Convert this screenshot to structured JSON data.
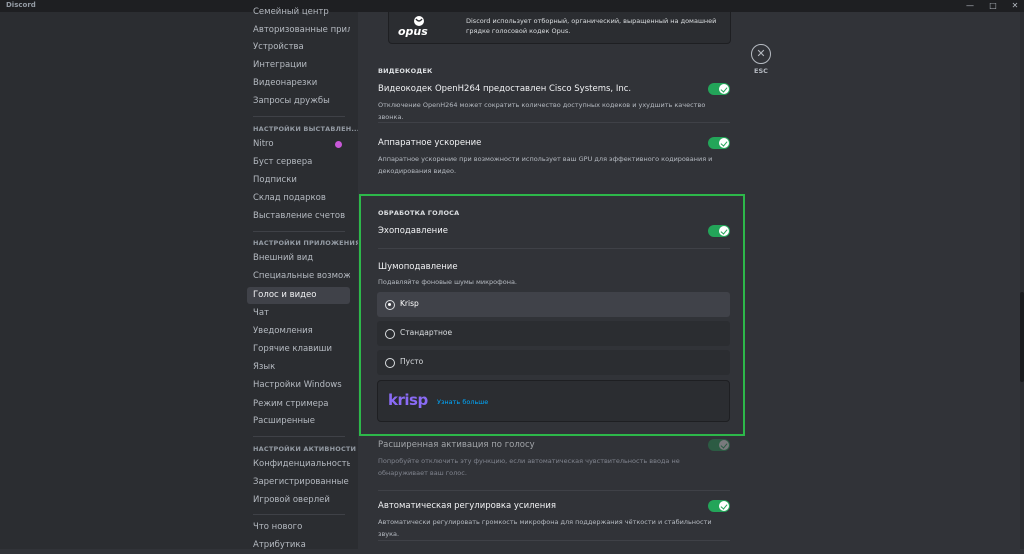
{
  "window": {
    "title": "Discord",
    "controls": [
      "—",
      "□",
      "✕"
    ]
  },
  "sidebar": {
    "items_top": [
      "Семейный центр",
      "Авторизованные прил...",
      "Устройства",
      "Интеграции",
      "Видеонарезки",
      "Запросы дружбы"
    ],
    "billing_header": "НАСТРОЙКИ ВЫСТАВЛЕН...",
    "billing_items": [
      "Nitro",
      "Буст сервера",
      "Подписки",
      "Склад подарков",
      "Выставление счетов"
    ],
    "app_header": "НАСТРОЙКИ ПРИЛОЖЕНИЯ",
    "app_items": [
      "Внешний вид",
      "Специальные возмож...",
      "Голос и видео",
      "Чат",
      "Уведомления",
      "Горячие клавиши",
      "Язык",
      "Настройки Windows",
      "Режим стримера",
      "Расширенные"
    ],
    "activity_header": "НАСТРОЙКИ АКТИВНОСТИ",
    "activity_items": [
      "Конфиденциальность ...",
      "Зарегистрированные ...",
      "Игровой оверлей"
    ],
    "misc_items": [
      "Что нового",
      "Атрибутика"
    ]
  },
  "opus": {
    "logo": "opus",
    "text": "Discord использует отборный, органический, выращенный на домашней грядке голосовой кодек Opus."
  },
  "video_codec": {
    "header": "ВИДЕОКОДЕК",
    "title": "Видеокодек OpenH264 предоставлен Cisco Systems, Inc.",
    "desc": "Отключение OpenH264 может сократить количество доступных кодеков и ухудшить качество звонка."
  },
  "hw_accel": {
    "title": "Аппаратное ускорение",
    "desc": "Аппаратное ускорение при возможности использует ваш GPU для эффективного кодирования и декодирования видео."
  },
  "voice_processing": {
    "header": "ОБРАБОТКА ГОЛОСА",
    "echo_title": "Эхоподавление",
    "noise_title": "Шумоподавление",
    "noise_desc": "Подавляйте фоновые шумы микрофона.",
    "options": [
      "Krisp",
      "Стандартное",
      "Пусто"
    ],
    "selected": "Krisp",
    "krisp_logo": "krisp",
    "krisp_link": "Узнать больше"
  },
  "advanced_vad": {
    "title": "Расширенная активация по голосу",
    "desc": "Попробуйте отключить эту функцию, если автоматическая чувствительность ввода не обнаруживает ваш голос."
  },
  "agc": {
    "title": "Автоматическая регулировка усиления",
    "desc": "Автоматически регулировать громкость микрофона для поддержания чёткости и стабильности звука."
  },
  "esc": {
    "icon": "✕",
    "label": "ESC"
  }
}
